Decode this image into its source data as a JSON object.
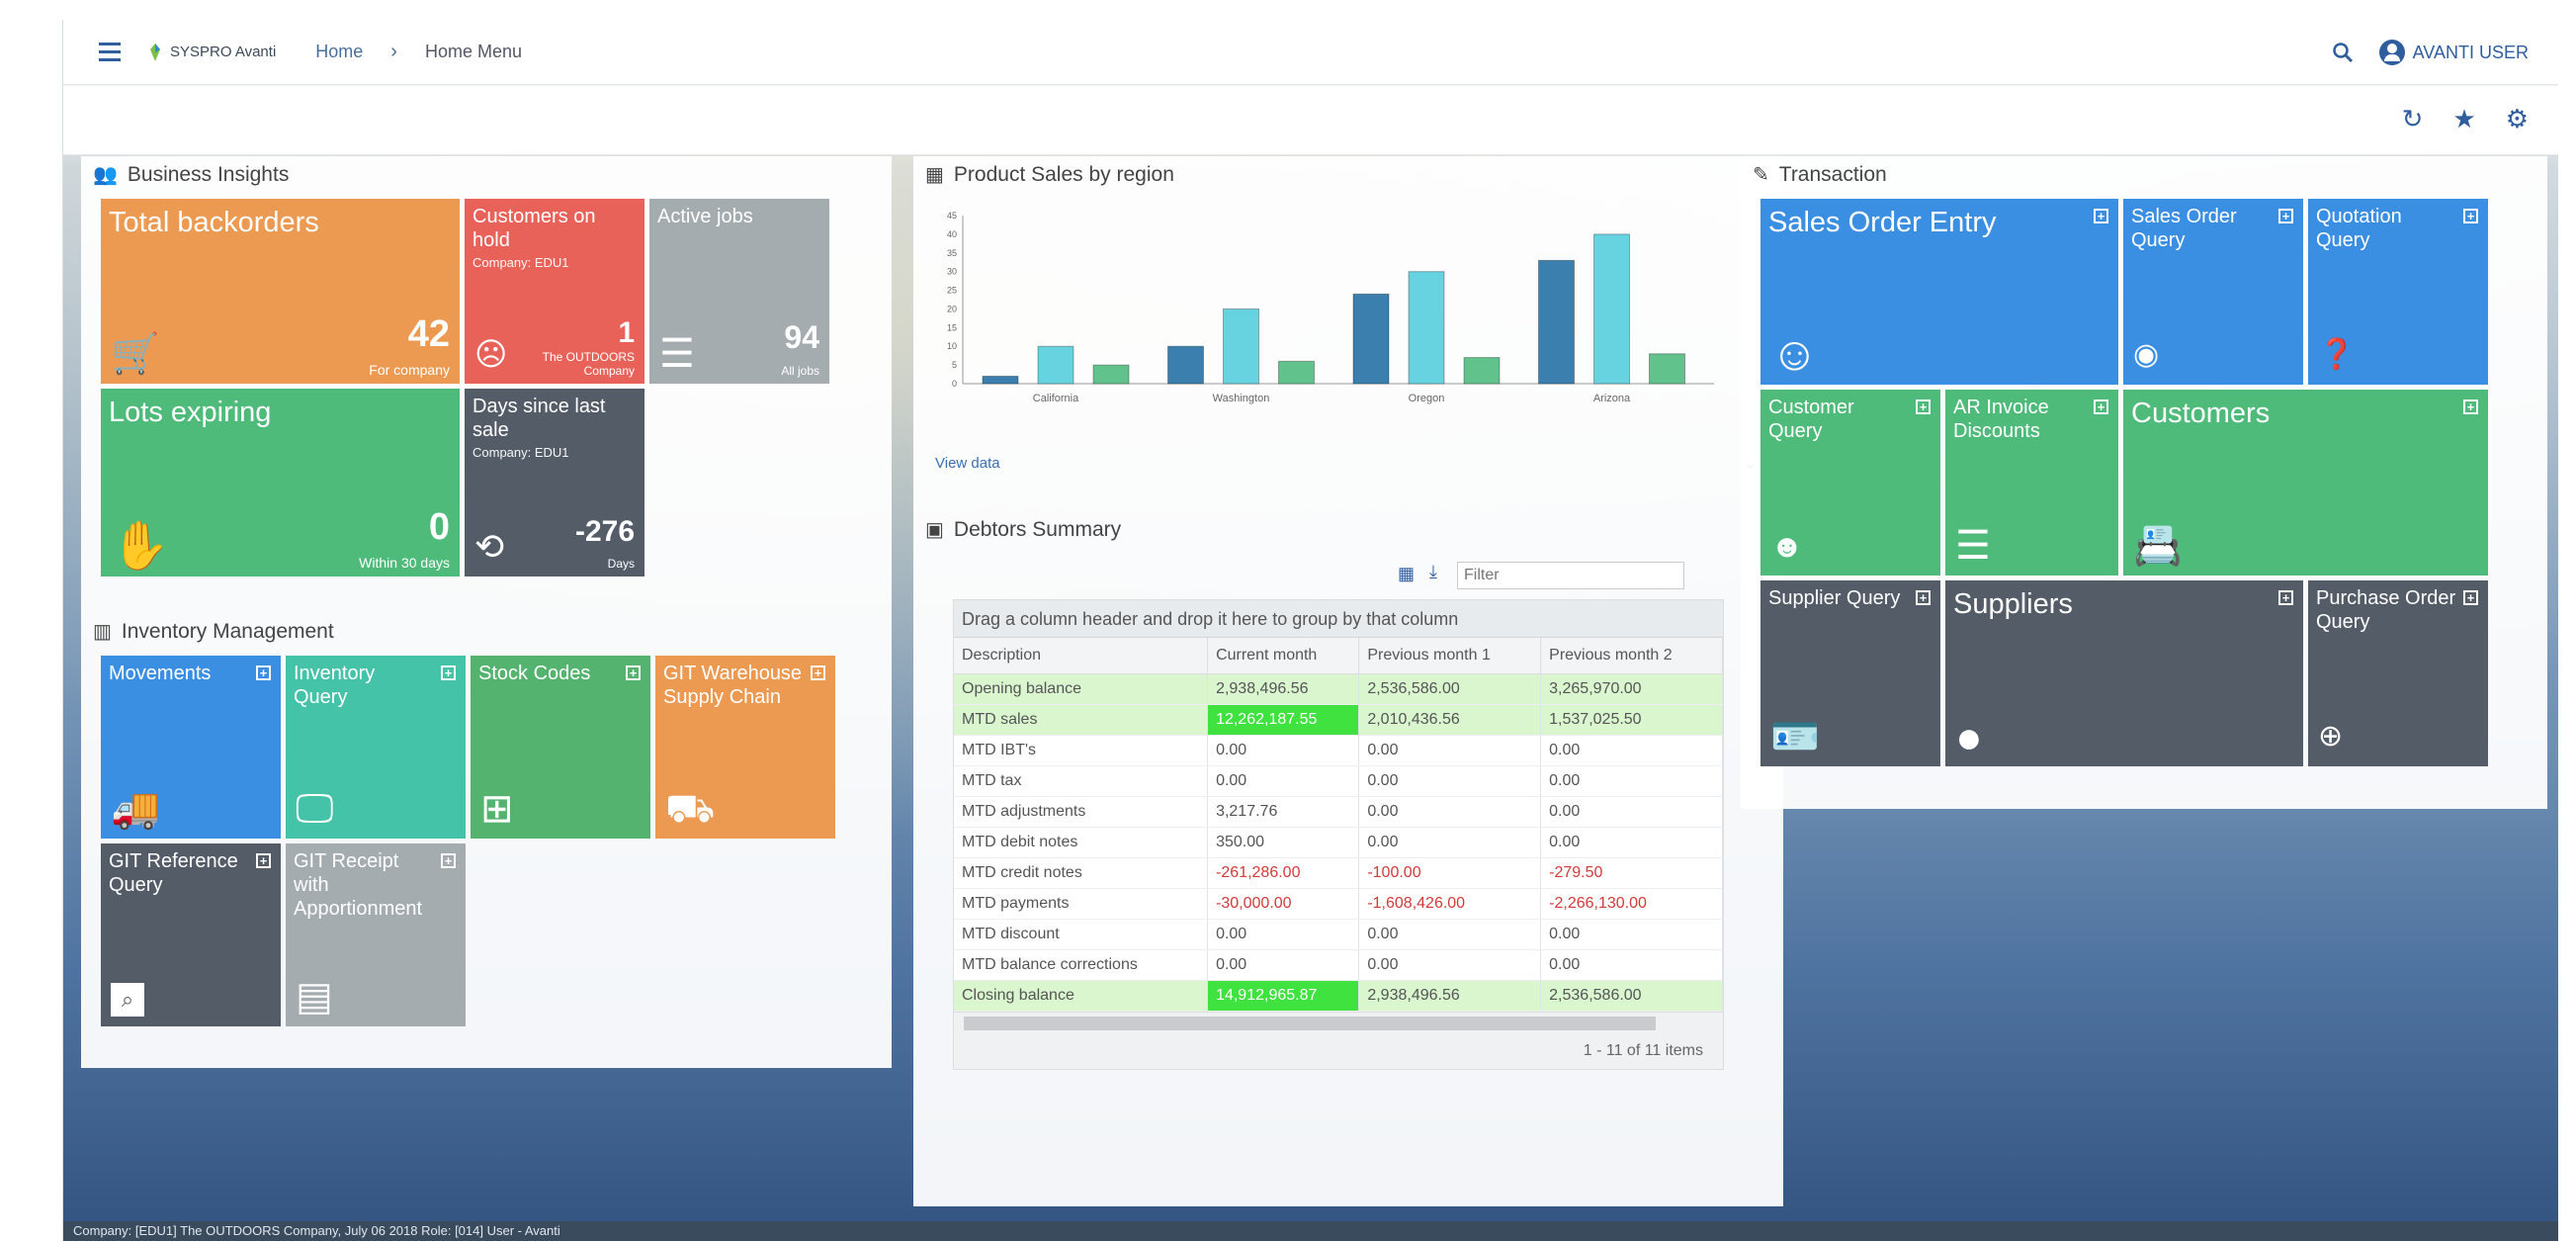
{
  "header": {
    "logo_text": "SYSPRO Avanti",
    "crumb_home": "Home",
    "crumb_sep": "›",
    "crumb_current": "Home Menu",
    "user": "AVANTI USER"
  },
  "business_insights": {
    "title": "Business Insights",
    "tiles": {
      "backorders": {
        "title": "Total backorders",
        "value": "42",
        "label": "For company"
      },
      "hold": {
        "title": "Customers on hold",
        "sub": "Company: EDU1",
        "value": "1",
        "label": "The OUTDOORS Company"
      },
      "jobs": {
        "title": "Active jobs",
        "value": "94",
        "label": "All jobs"
      },
      "lots": {
        "title": "Lots expiring",
        "value": "0",
        "label": "Within 30 days"
      },
      "days": {
        "title": "Days since last sale",
        "sub": "Company: EDU1",
        "value": "-276",
        "label": "Days"
      }
    }
  },
  "inventory": {
    "title": "Inventory Management",
    "tiles": [
      {
        "title": "Movements"
      },
      {
        "title": "Inventory Query"
      },
      {
        "title": "Stock Codes"
      },
      {
        "title": "GIT Warehouse Supply Chain"
      },
      {
        "title": "GIT Reference Query"
      },
      {
        "title": "GIT Receipt with Apportionment"
      }
    ]
  },
  "product_sales": {
    "title": "Product Sales by region",
    "view_data": "View data"
  },
  "chart_data": {
    "type": "bar",
    "categories": [
      "California",
      "Washington",
      "Oregon",
      "Arizona"
    ],
    "series": [
      {
        "values": [
          2,
          10,
          24,
          33
        ]
      },
      {
        "values": [
          10,
          20,
          30,
          40
        ]
      },
      {
        "values": [
          5,
          6,
          7,
          8
        ]
      }
    ],
    "ylim": [
      0,
      45
    ],
    "yticks": [
      0,
      5,
      10,
      15,
      20,
      25,
      30,
      35,
      40,
      45
    ],
    "colors": [
      "#3a7fae",
      "#68d3e0",
      "#62c28c"
    ]
  },
  "debtors": {
    "title": "Debtors Summary",
    "filter_placeholder": "Filter",
    "group_hint": "Drag a column header and drop it here to group by that column",
    "columns": [
      "Description",
      "Current month",
      "Previous month 1",
      "Previous month 2"
    ],
    "rows": [
      [
        "Opening balance",
        "2,938,496.56",
        "2,536,586.00",
        "3,265,970.00"
      ],
      [
        "MTD sales",
        "12,262,187.55",
        "2,010,436.56",
        "1,537,025.50"
      ],
      [
        "MTD IBT's",
        "0.00",
        "0.00",
        "0.00"
      ],
      [
        "MTD tax",
        "0.00",
        "0.00",
        "0.00"
      ],
      [
        "MTD adjustments",
        "3,217.76",
        "0.00",
        "0.00"
      ],
      [
        "MTD debit notes",
        "350.00",
        "0.00",
        "0.00"
      ],
      [
        "MTD credit notes",
        "-261,286.00",
        "-100.00",
        "-279.50"
      ],
      [
        "MTD payments",
        "-30,000.00",
        "-1,608,426.00",
        "-2,266,130.00"
      ],
      [
        "MTD discount",
        "0.00",
        "0.00",
        "0.00"
      ],
      [
        "MTD balance corrections",
        "0.00",
        "0.00",
        "0.00"
      ],
      [
        "Closing balance",
        "14,912,965.87",
        "2,938,496.56",
        "2,536,586.00"
      ]
    ],
    "pager": "1 - 11 of 11 items"
  },
  "transaction": {
    "title": "Transaction",
    "tiles": [
      {
        "title": "Sales Order Entry"
      },
      {
        "title": "Sales Order Query"
      },
      {
        "title": "Quotation Query"
      },
      {
        "title": "Customer Query"
      },
      {
        "title": "AR Invoice Discounts"
      },
      {
        "title": "Customers"
      },
      {
        "title": "Supplier Query"
      },
      {
        "title": "Suppliers"
      },
      {
        "title": "Purchase Order Query"
      }
    ]
  },
  "status": "Company: [EDU1] The OUTDOORS Company, July 06 2018 Role: [014] User - Avanti"
}
